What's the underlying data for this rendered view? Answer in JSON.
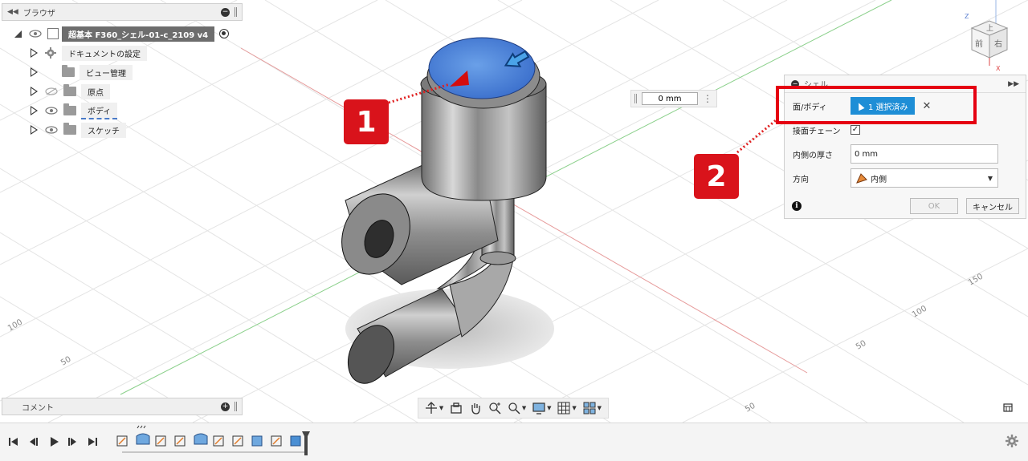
{
  "browser": {
    "title": "ブラウザ",
    "root": "超基本 F360_シェル-01-c_2109 v4",
    "items": [
      {
        "label": "ドキュメントの設定",
        "icon": "gear-icon"
      },
      {
        "label": "ビュー管理",
        "icon": "folder-icon"
      },
      {
        "label": "原点",
        "icon": "folder-icon"
      },
      {
        "label": "ボディ",
        "icon": "folder-icon"
      },
      {
        "label": "スケッチ",
        "icon": "folder-icon"
      }
    ]
  },
  "comments": {
    "title": "コメント"
  },
  "measure": {
    "value": "0 mm"
  },
  "shell": {
    "title": "シェル",
    "face_label": "面/ボディ",
    "face_button": "1 選択済み",
    "tangent_label": "接面チェーン",
    "thickness_label": "内側の厚さ",
    "thickness_value": "0 mm",
    "direction_label": "方向",
    "direction_value": "内側",
    "ok": "OK",
    "cancel": "キャンセル"
  },
  "callouts": {
    "one": "1",
    "two": "2"
  },
  "viewcube": {
    "top": "上",
    "front": "前",
    "right": "右"
  },
  "grid_labels": [
    "100",
    "50",
    "150",
    "100",
    "50",
    "50"
  ],
  "colors": {
    "accent": "#1e8ed6",
    "highlight": "#e50012",
    "callout": "#d9131b"
  }
}
